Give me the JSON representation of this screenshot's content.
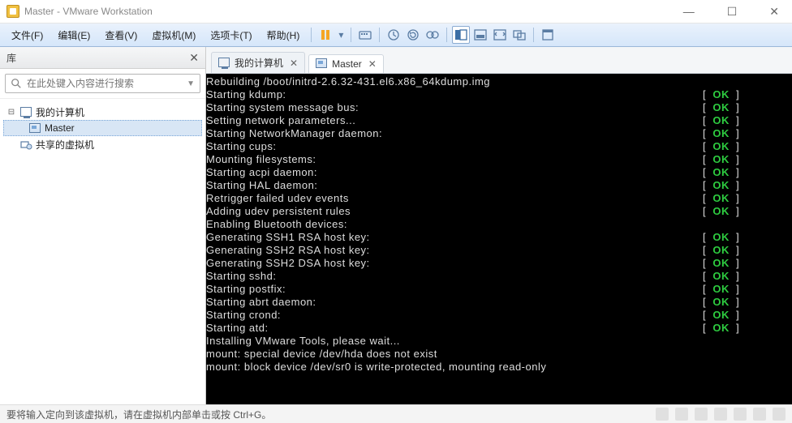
{
  "window": {
    "title": "Master - VMware Workstation"
  },
  "menu": {
    "file": "文件(F)",
    "edit": "编辑(E)",
    "view": "查看(V)",
    "vm": "虚拟机(M)",
    "tabs": "选项卡(T)",
    "help": "帮助(H)"
  },
  "sidebar": {
    "title": "库",
    "search_placeholder": "在此处键入内容进行搜索",
    "root": "我的计算机",
    "master": "Master",
    "shared": "共享的虚拟机"
  },
  "tabs": {
    "home": "我的计算机",
    "master": "Master"
  },
  "terminal": {
    "lines": [
      {
        "msg": "Rebuilding /boot/initrd-2.6.32-431.el6.x86_64kdump.img",
        "status": ""
      },
      {
        "msg": "Starting kdump:",
        "status": "OK"
      },
      {
        "msg": "Starting system message bus:",
        "status": "OK"
      },
      {
        "msg": "Setting network parameters...",
        "status": "OK"
      },
      {
        "msg": "Starting NetworkManager daemon:",
        "status": "OK"
      },
      {
        "msg": "Starting cups:",
        "status": "OK"
      },
      {
        "msg": "Mounting filesystems:",
        "status": "OK"
      },
      {
        "msg": "Starting acpi daemon:",
        "status": "OK"
      },
      {
        "msg": "Starting HAL daemon:",
        "status": "OK"
      },
      {
        "msg": "Retrigger failed udev events",
        "status": "OK"
      },
      {
        "msg": "Adding udev persistent rules",
        "status": "OK"
      },
      {
        "msg": "Enabling Bluetooth devices:",
        "status": ""
      },
      {
        "msg": "Generating SSH1 RSA host key:",
        "status": "OK"
      },
      {
        "msg": "Generating SSH2 RSA host key:",
        "status": "OK"
      },
      {
        "msg": "Generating SSH2 DSA host key:",
        "status": "OK"
      },
      {
        "msg": "Starting sshd:",
        "status": "OK"
      },
      {
        "msg": "Starting postfix:",
        "status": "OK"
      },
      {
        "msg": "Starting abrt daemon:",
        "status": "OK"
      },
      {
        "msg": "Starting crond:",
        "status": "OK"
      },
      {
        "msg": "Starting atd:",
        "status": "OK"
      },
      {
        "msg": "",
        "status": ""
      },
      {
        "msg": "Installing VMware Tools, please wait...",
        "status": ""
      },
      {
        "msg": "mount: special device /dev/hda does not exist",
        "status": ""
      },
      {
        "msg": "mount: block device /dev/sr0 is write-protected, mounting read-only",
        "status": ""
      }
    ]
  },
  "statusbar": {
    "hint": "要将输入定向到该虚拟机，请在虚拟机内部单击或按 Ctrl+G。"
  }
}
